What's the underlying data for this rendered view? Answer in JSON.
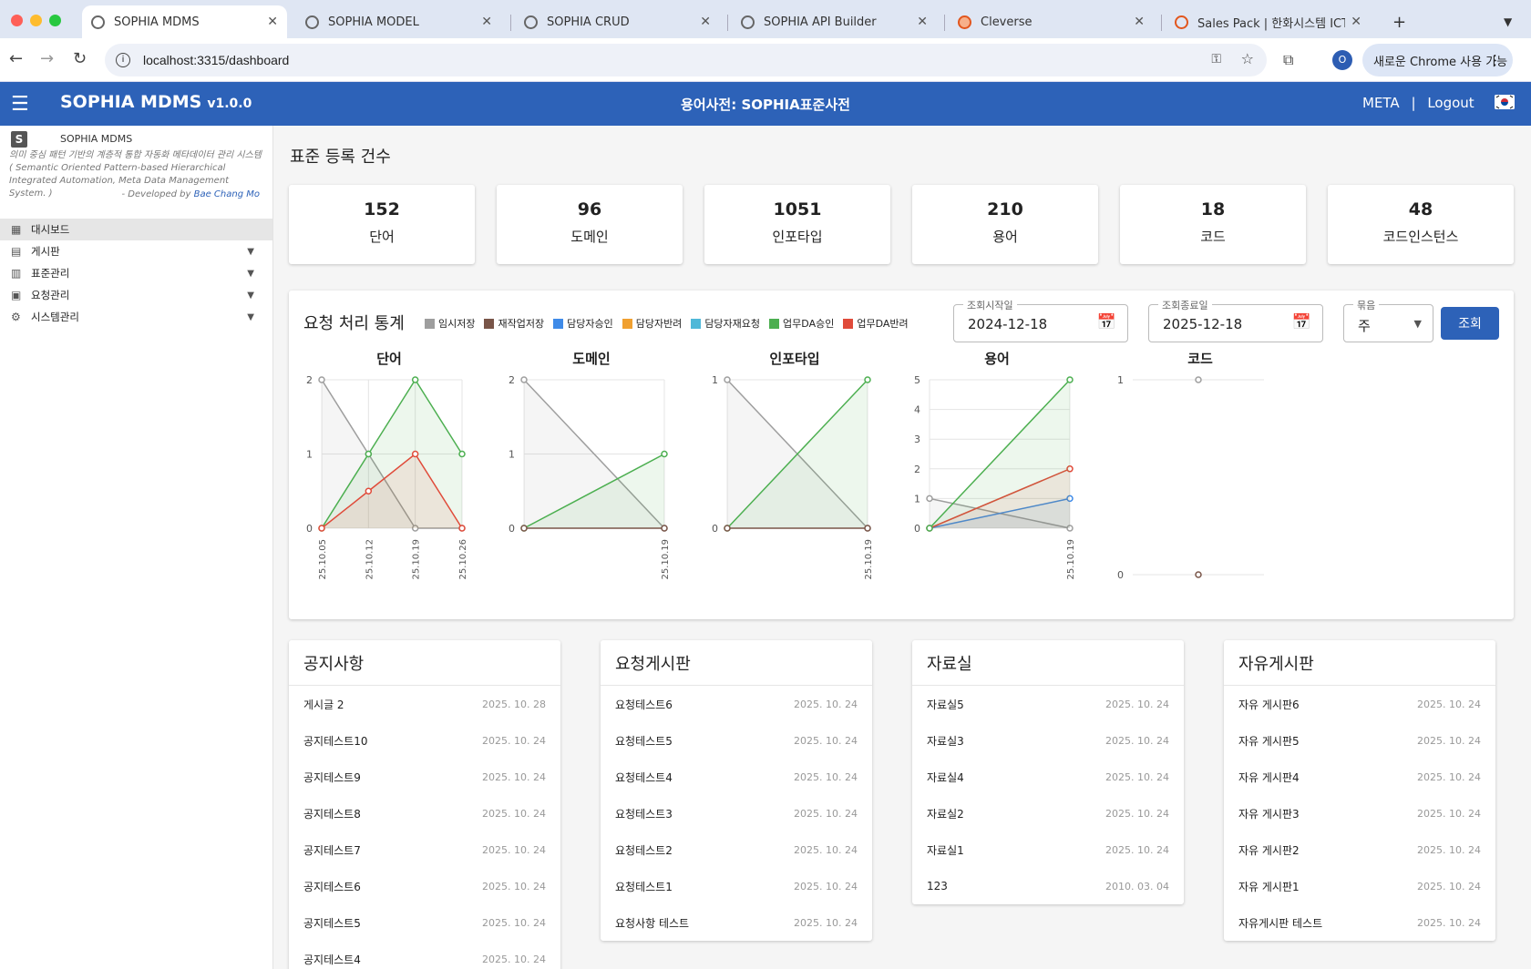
{
  "browser": {
    "tabs": [
      {
        "label": "SOPHIA MDMS"
      },
      {
        "label": "SOPHIA MODEL"
      },
      {
        "label": "SOPHIA CRUD"
      },
      {
        "label": "SOPHIA API Builder"
      },
      {
        "label": "Cleverse"
      },
      {
        "label": "Sales Pack | 한화시스템 ICT 부문"
      }
    ],
    "new_tab": "+",
    "url": "localhost:3315/dashboard",
    "profile_initial": "O",
    "chrome_button": "새로운 Chrome 사용 가능"
  },
  "header": {
    "app_title": "SOPHIA MDMS",
    "version": "v1.0.0",
    "dictionary": "용어사전: SOPHIA표준사전",
    "meta_link": "META",
    "separator": "|",
    "logout_link": "Logout"
  },
  "sidebar": {
    "logo_letter": "S",
    "app_name": "SOPHIA MDMS",
    "description": "의미 중심 패턴 기반의 계층적 통합 자동화 메타데이터 관리 시스템 ( Semantic Oriented Pattern-based Hierarchical Integrated Automation, Meta Data Management System. )",
    "developed_by": "- Developed by",
    "developer": "Bae Chang Mo",
    "items": [
      {
        "label": "대시보드",
        "icon": "dashboard-icon"
      },
      {
        "label": "게시판",
        "icon": "board-icon"
      },
      {
        "label": "표준관리",
        "icon": "standard-icon"
      },
      {
        "label": "요청관리",
        "icon": "request-icon"
      },
      {
        "label": "시스템관리",
        "icon": "gear-icon"
      }
    ]
  },
  "kpi": {
    "title": "표준 등록 건수",
    "cards": [
      {
        "value": "152",
        "label": "단어"
      },
      {
        "value": "96",
        "label": "도메인"
      },
      {
        "value": "1051",
        "label": "인포타입"
      },
      {
        "value": "210",
        "label": "용어"
      },
      {
        "value": "18",
        "label": "코드"
      },
      {
        "value": "48",
        "label": "코드인스턴스"
      }
    ]
  },
  "stats": {
    "title": "요청 처리 통계",
    "legend": [
      {
        "name": "임시저장",
        "color": "#9e9e9e"
      },
      {
        "name": "재작업저장",
        "color": "#795548"
      },
      {
        "name": "담당자승인",
        "color": "#3f8be8"
      },
      {
        "name": "담당자반려",
        "color": "#f0a030"
      },
      {
        "name": "담당자재요청",
        "color": "#4fb8d8"
      },
      {
        "name": "업무DA승인",
        "color": "#4caf50"
      },
      {
        "name": "업무DA반려",
        "color": "#e04b3a"
      }
    ],
    "start_label": "조회시작일",
    "start_value": "2024-12-18",
    "end_label": "조회종료일",
    "end_value": "2025-12-18",
    "group_label": "묶음",
    "group_value": "주",
    "search_button": "조회"
  },
  "chart_data": [
    {
      "type": "line",
      "title": "단어",
      "x": [
        "25.10.05",
        "25.10.12",
        "25.10.19",
        "25.10.26"
      ],
      "ylim": [
        0,
        2
      ],
      "y_ticks": [
        0,
        1,
        2
      ],
      "series": [
        {
          "name": "임시저장",
          "values": [
            2,
            1,
            0,
            0
          ],
          "color": "#9e9e9e"
        },
        {
          "name": "업무DA승인",
          "values": [
            0,
            1,
            2,
            1
          ],
          "color": "#4caf50"
        },
        {
          "name": "업무DA반려",
          "values": [
            0,
            0.5,
            1,
            0
          ],
          "color": "#e04b3a"
        }
      ]
    },
    {
      "type": "line",
      "title": "도메인",
      "x": [
        "",
        "25.10.19"
      ],
      "ylim": [
        0,
        2
      ],
      "y_ticks": [
        0,
        1,
        2
      ],
      "series": [
        {
          "name": "임시저장",
          "values": [
            2,
            0
          ],
          "color": "#9e9e9e"
        },
        {
          "name": "업무DA승인",
          "values": [
            0,
            1
          ],
          "color": "#4caf50"
        },
        {
          "name": "재작업저장",
          "values": [
            0,
            0
          ],
          "color": "#795548"
        }
      ]
    },
    {
      "type": "line",
      "title": "인포타입",
      "x": [
        "",
        "25.10.19"
      ],
      "ylim": [
        0,
        1
      ],
      "y_ticks": [
        0,
        1
      ],
      "series": [
        {
          "name": "임시저장",
          "values": [
            1,
            0
          ],
          "color": "#9e9e9e"
        },
        {
          "name": "업무DA승인",
          "values": [
            0,
            1
          ],
          "color": "#4caf50"
        },
        {
          "name": "재작업저장",
          "values": [
            0,
            0
          ],
          "color": "#795548"
        }
      ]
    },
    {
      "type": "line",
      "title": "용어",
      "x": [
        "",
        "25.10.19"
      ],
      "ylim": [
        0,
        5
      ],
      "y_ticks": [
        0,
        1,
        2,
        3,
        4,
        5
      ],
      "series": [
        {
          "name": "임시저장",
          "values": [
            1,
            0
          ],
          "color": "#9e9e9e"
        },
        {
          "name": "담당자승인",
          "values": [
            0,
            1
          ],
          "color": "#3f8be8"
        },
        {
          "name": "업무DA반려",
          "values": [
            0,
            2
          ],
          "color": "#e04b3a"
        },
        {
          "name": "업무DA승인",
          "values": [
            0,
            5
          ],
          "color": "#4caf50"
        }
      ]
    },
    {
      "type": "line",
      "title": "코드",
      "x": [
        ""
      ],
      "ylim": [
        0,
        1
      ],
      "y_ticks": [
        0,
        1
      ],
      "series": [
        {
          "name": "임시저장",
          "values": [
            1
          ],
          "color": "#9e9e9e"
        },
        {
          "name": "재작업저장",
          "values": [
            0
          ],
          "color": "#795548"
        }
      ]
    }
  ],
  "boards": [
    {
      "title": "공지사항",
      "rows": [
        {
          "title": "게시글 2",
          "date": "2025. 10. 28"
        },
        {
          "title": "공지테스트10",
          "date": "2025. 10. 24"
        },
        {
          "title": "공지테스트9",
          "date": "2025. 10. 24"
        },
        {
          "title": "공지테스트8",
          "date": "2025. 10. 24"
        },
        {
          "title": "공지테스트7",
          "date": "2025. 10. 24"
        },
        {
          "title": "공지테스트6",
          "date": "2025. 10. 24"
        },
        {
          "title": "공지테스트5",
          "date": "2025. 10. 24"
        },
        {
          "title": "공지테스트4",
          "date": "2025. 10. 24"
        }
      ]
    },
    {
      "title": "요청게시판",
      "rows": [
        {
          "title": "요청테스트6",
          "date": "2025. 10. 24"
        },
        {
          "title": "요청테스트5",
          "date": "2025. 10. 24"
        },
        {
          "title": "요청테스트4",
          "date": "2025. 10. 24"
        },
        {
          "title": "요청테스트3",
          "date": "2025. 10. 24"
        },
        {
          "title": "요청테스트2",
          "date": "2025. 10. 24"
        },
        {
          "title": "요청테스트1",
          "date": "2025. 10. 24"
        },
        {
          "title": "요청사항 테스트",
          "date": "2025. 10. 24"
        }
      ]
    },
    {
      "title": "자료실",
      "rows": [
        {
          "title": "자료실5",
          "date": "2025. 10. 24"
        },
        {
          "title": "자료실3",
          "date": "2025. 10. 24"
        },
        {
          "title": "자료실4",
          "date": "2025. 10. 24"
        },
        {
          "title": "자료실2",
          "date": "2025. 10. 24"
        },
        {
          "title": "자료실1",
          "date": "2025. 10. 24"
        },
        {
          "title": "123",
          "date": "2010. 03. 04"
        }
      ]
    },
    {
      "title": "자유게시판",
      "rows": [
        {
          "title": "자유 게시판6",
          "date": "2025. 10. 24"
        },
        {
          "title": "자유 게시판5",
          "date": "2025. 10. 24"
        },
        {
          "title": "자유 게시판4",
          "date": "2025. 10. 24"
        },
        {
          "title": "자유 게시판3",
          "date": "2025. 10. 24"
        },
        {
          "title": "자유 게시판2",
          "date": "2025. 10. 24"
        },
        {
          "title": "자유 게시판1",
          "date": "2025. 10. 24"
        },
        {
          "title": "자유게시판 테스트",
          "date": "2025. 10. 24"
        }
      ]
    }
  ]
}
